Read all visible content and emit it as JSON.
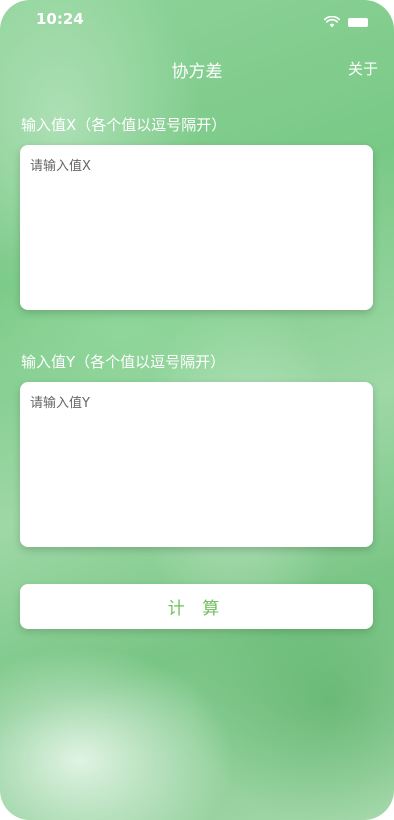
{
  "status_bar": {
    "time": "10:24",
    "icons": [
      "wifi-icon",
      "battery-icon"
    ]
  },
  "nav": {
    "title": "协方差",
    "about_label": "关于"
  },
  "form": {
    "x_label": "输入值X（各个值以逗号隔开）",
    "x_placeholder": "请输入值X",
    "x_value": "",
    "y_label": "输入值Y（各个值以逗号隔开）",
    "y_placeholder": "请输入值Y",
    "y_value": "",
    "calculate_label": "计 算"
  },
  "colors": {
    "accent": "#6fbf5b",
    "background": "#86ce91"
  }
}
